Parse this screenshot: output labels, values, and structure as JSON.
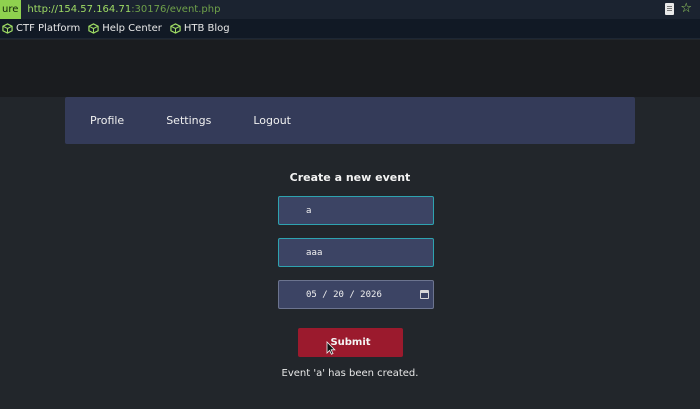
{
  "browser": {
    "secure_label": "ure",
    "url_host": "http://154.57.164.71",
    "url_path": ":30176/event.php",
    "icons": [
      "page-info-icon",
      "bookmark-star-icon"
    ]
  },
  "bookmarks": [
    {
      "label": "CTF Platform",
      "icon": "htb-cube-icon"
    },
    {
      "label": "Help Center",
      "icon": "htb-cube-icon"
    },
    {
      "label": "HTB Blog",
      "icon": "htb-cube-icon"
    }
  ],
  "nav": {
    "items": [
      "Profile",
      "Settings",
      "Logout"
    ]
  },
  "form": {
    "title": "Create a new event",
    "name_value": "a",
    "description_value": "aaa",
    "date_value": "05 / 20 / 2026",
    "submit_label": "Submit"
  },
  "status": {
    "message": "Event 'a' has been created."
  },
  "colors": {
    "accent_green": "#9fdc64",
    "nav_bg": "#343b59",
    "field_border": "#2ea3b0",
    "submit_bg": "#9b1a2d"
  }
}
